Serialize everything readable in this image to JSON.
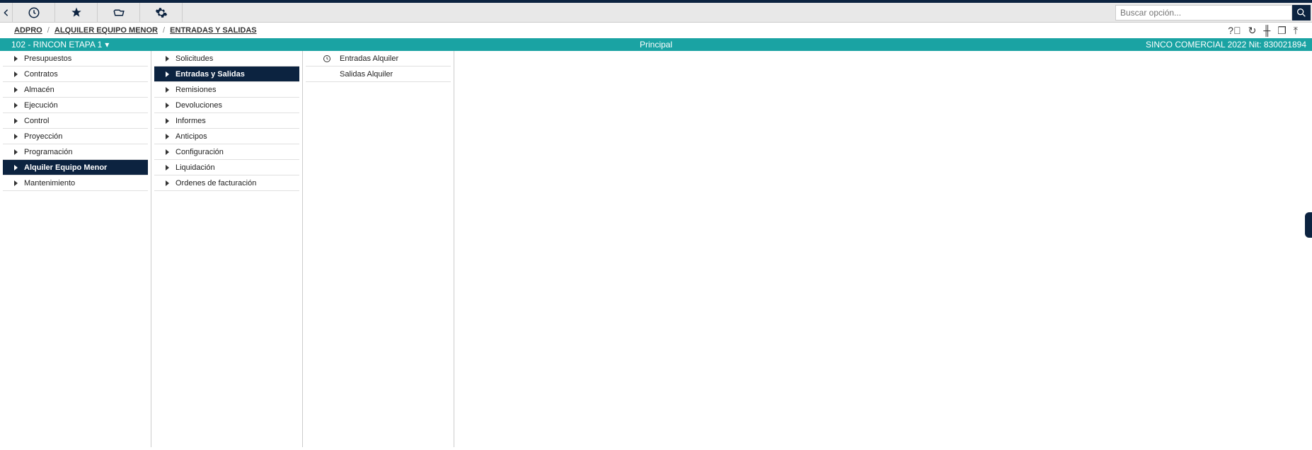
{
  "toolbar": {
    "search_placeholder": "Buscar opción..."
  },
  "breadcrumb": {
    "items": [
      "ADPRO",
      "ALQUILER EQUIPO MENOR",
      "ENTRADAS Y SALIDAS"
    ]
  },
  "teal": {
    "project": "102 - RINCON ETAPA 1",
    "caret": "▾",
    "center": "Principal",
    "right": "SINCO COMERCIAL 2022 Nit: 830021894"
  },
  "col1": {
    "items": [
      {
        "label": "Presupuestos",
        "active": false
      },
      {
        "label": "Contratos",
        "active": false
      },
      {
        "label": "Almacén",
        "active": false
      },
      {
        "label": "Ejecución",
        "active": false
      },
      {
        "label": "Control",
        "active": false
      },
      {
        "label": "Proyección",
        "active": false
      },
      {
        "label": "Programación",
        "active": false
      },
      {
        "label": "Alquiler Equipo Menor",
        "active": true
      },
      {
        "label": "Mantenimiento",
        "active": false
      }
    ]
  },
  "col2": {
    "items": [
      {
        "label": "Solicitudes",
        "active": false
      },
      {
        "label": "Entradas y Salidas",
        "active": true
      },
      {
        "label": "Remisiones",
        "active": false
      },
      {
        "label": "Devoluciones",
        "active": false
      },
      {
        "label": "Informes",
        "active": false
      },
      {
        "label": "Anticipos",
        "active": false
      },
      {
        "label": "Configuración",
        "active": false
      },
      {
        "label": "Liquidación",
        "active": false
      },
      {
        "label": "Ordenes de facturación",
        "active": false
      }
    ]
  },
  "col3": {
    "items": [
      {
        "label": "Entradas Alquiler",
        "clock": true
      },
      {
        "label": "Salidas Alquiler",
        "clock": false
      }
    ]
  }
}
